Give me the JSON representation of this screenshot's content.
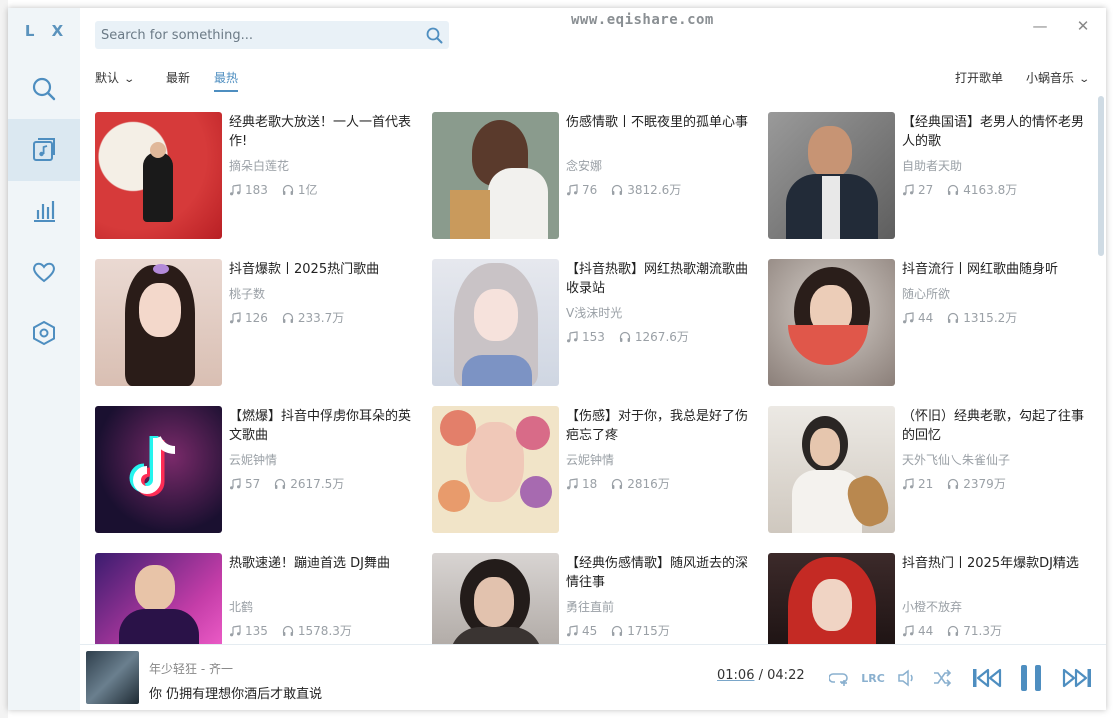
{
  "app": {
    "logo": "L X",
    "watermark": "www.eqishare.com"
  },
  "window": {
    "minimize": "—",
    "close": "✕"
  },
  "search": {
    "placeholder": "Search for something..."
  },
  "sort_tabs": [
    {
      "label": "默认",
      "has_dropdown": true
    },
    {
      "label": "最新"
    },
    {
      "label": "最热",
      "active": true
    }
  ],
  "right_links": {
    "open_playlist": "打开歌单",
    "source": "小蜗音乐"
  },
  "sidebar": {
    "items": [
      {
        "name": "search",
        "icon": "search-icon"
      },
      {
        "name": "songlist",
        "icon": "music-list-icon",
        "active": true
      },
      {
        "name": "leaderboard",
        "icon": "bar-chart-icon"
      },
      {
        "name": "favorites",
        "icon": "heart-icon"
      },
      {
        "name": "settings",
        "icon": "hexagon-settings-icon"
      }
    ]
  },
  "playlists": [
    {
      "title": "经典老歌大放送！一人一首代表作!",
      "author": "摘朵白莲花",
      "songs": "183",
      "plays": "1亿"
    },
    {
      "title": "伤感情歌丨不眠夜里的孤单心事",
      "author": "念安娜",
      "songs": "76",
      "plays": "3812.6万"
    },
    {
      "title": "【经典国语】老男人的情怀老男人的歌",
      "author": "自助者天助",
      "songs": "27",
      "plays": "4163.8万"
    },
    {
      "title": "抖音爆款丨2025热门歌曲",
      "author": "桃子数",
      "songs": "126",
      "plays": "233.7万"
    },
    {
      "title": "【抖音热歌】网红热歌潮流歌曲收录站",
      "author": "V浅沫时光",
      "songs": "153",
      "plays": "1267.6万"
    },
    {
      "title": "抖音流行丨网红歌曲随身听",
      "author": "随心所欲",
      "songs": "44",
      "plays": "1315.2万"
    },
    {
      "title": "【燃爆】抖音中俘虏你耳朵的英文歌曲",
      "author": "云妮钟情",
      "songs": "57",
      "plays": "2617.5万"
    },
    {
      "title": "【伤感】对于你，我总是好了伤疤忘了疼",
      "author": "云妮钟情",
      "songs": "18",
      "plays": "2816万"
    },
    {
      "title": "（怀旧）经典老歌，勾起了往事的回忆",
      "author": "天外飞仙乀朱雀仙子",
      "songs": "21",
      "plays": "2379万"
    },
    {
      "title": "热歌速递！蹦迪首选 DJ舞曲",
      "author": "北鹤",
      "songs": "135",
      "plays": "1578.3万"
    },
    {
      "title": "【经典伤感情歌】随风逝去的深情往事",
      "author": "勇往直前",
      "songs": "45",
      "plays": "1715万"
    },
    {
      "title": "抖音热门丨2025年爆款DJ精选",
      "author": "小橙不放弃",
      "songs": "44",
      "plays": "71.3万"
    }
  ],
  "player": {
    "song": "年少轻狂 - 齐一",
    "lyric": "你 仍拥有理想你酒后才敢直说",
    "current_time": "01:06",
    "separator": "/",
    "total_time": "04:22",
    "lrc_label": "LRC"
  },
  "colors": {
    "accent": "#4e8ec0",
    "sidebar_bg": "#f0f5f8",
    "sidebar_active": "#dbe8f1"
  }
}
